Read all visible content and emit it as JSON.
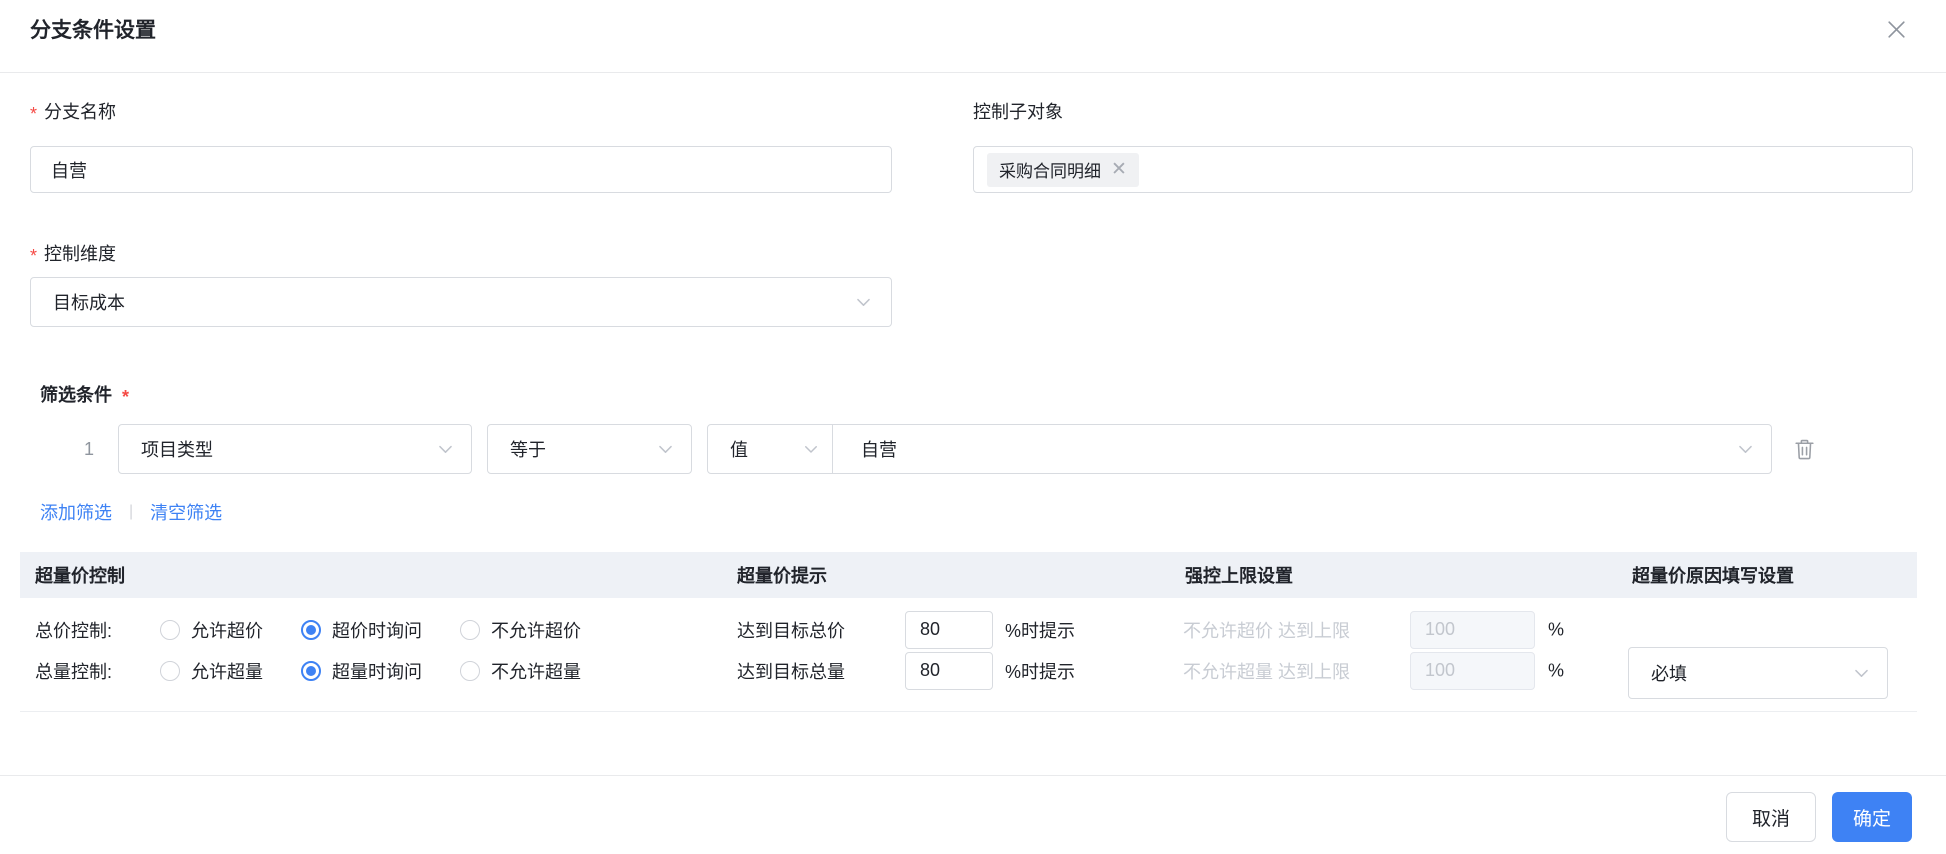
{
  "colors": {
    "accent": "#3e82f4",
    "required_mark": "#f54a45",
    "table_header_bg": "#eef1f6",
    "disabled_text": "#c8ccd3"
  },
  "marks": {
    "required": "*",
    "link_separator": "|"
  },
  "dialog": {
    "title": "分支条件设置"
  },
  "fields": {
    "branch_name": {
      "label": "分支名称",
      "value": "自营"
    },
    "control_sub_object": {
      "label": "控制子对象",
      "tag_label": "采购合同明细"
    },
    "control_dimension": {
      "label": "控制维度",
      "value": "目标成本"
    }
  },
  "filter": {
    "section_label": "筛选条件",
    "row": {
      "index": "1",
      "field": "项目类型",
      "operator": "等于",
      "value_type": "值",
      "value": "自营"
    },
    "add_label": "添加筛选",
    "clear_label": "清空筛选"
  },
  "control_table": {
    "headers": {
      "control": "超量价控制",
      "prompt": "超量价提示",
      "hard_limit": "强控上限设置",
      "reason": "超量价原因填写设置"
    },
    "price_row": {
      "label": "总价控制:",
      "option_allow": "允许超价",
      "option_ask": "超价时询问",
      "option_deny": "不允许超价",
      "selected_option": "超价时询问",
      "prompt_prefix": "达到目标总价",
      "prompt_value": "80",
      "prompt_suffix": "%时提示",
      "limit_text": "不允许超价 达到上限",
      "limit_value": "100",
      "limit_suffix": "%"
    },
    "quantity_row": {
      "label": "总量控制:",
      "option_allow": "允许超量",
      "option_ask": "超量时询问",
      "option_deny": "不允许超量",
      "selected_option": "超量时询问",
      "prompt_prefix": "达到目标总量",
      "prompt_value": "80",
      "prompt_suffix": "%时提示",
      "limit_text": "不允许超量 达到上限",
      "limit_value": "100",
      "limit_suffix": "%"
    },
    "reason_value": "必填"
  },
  "footer": {
    "cancel_label": "取消",
    "confirm_label": "确定"
  }
}
